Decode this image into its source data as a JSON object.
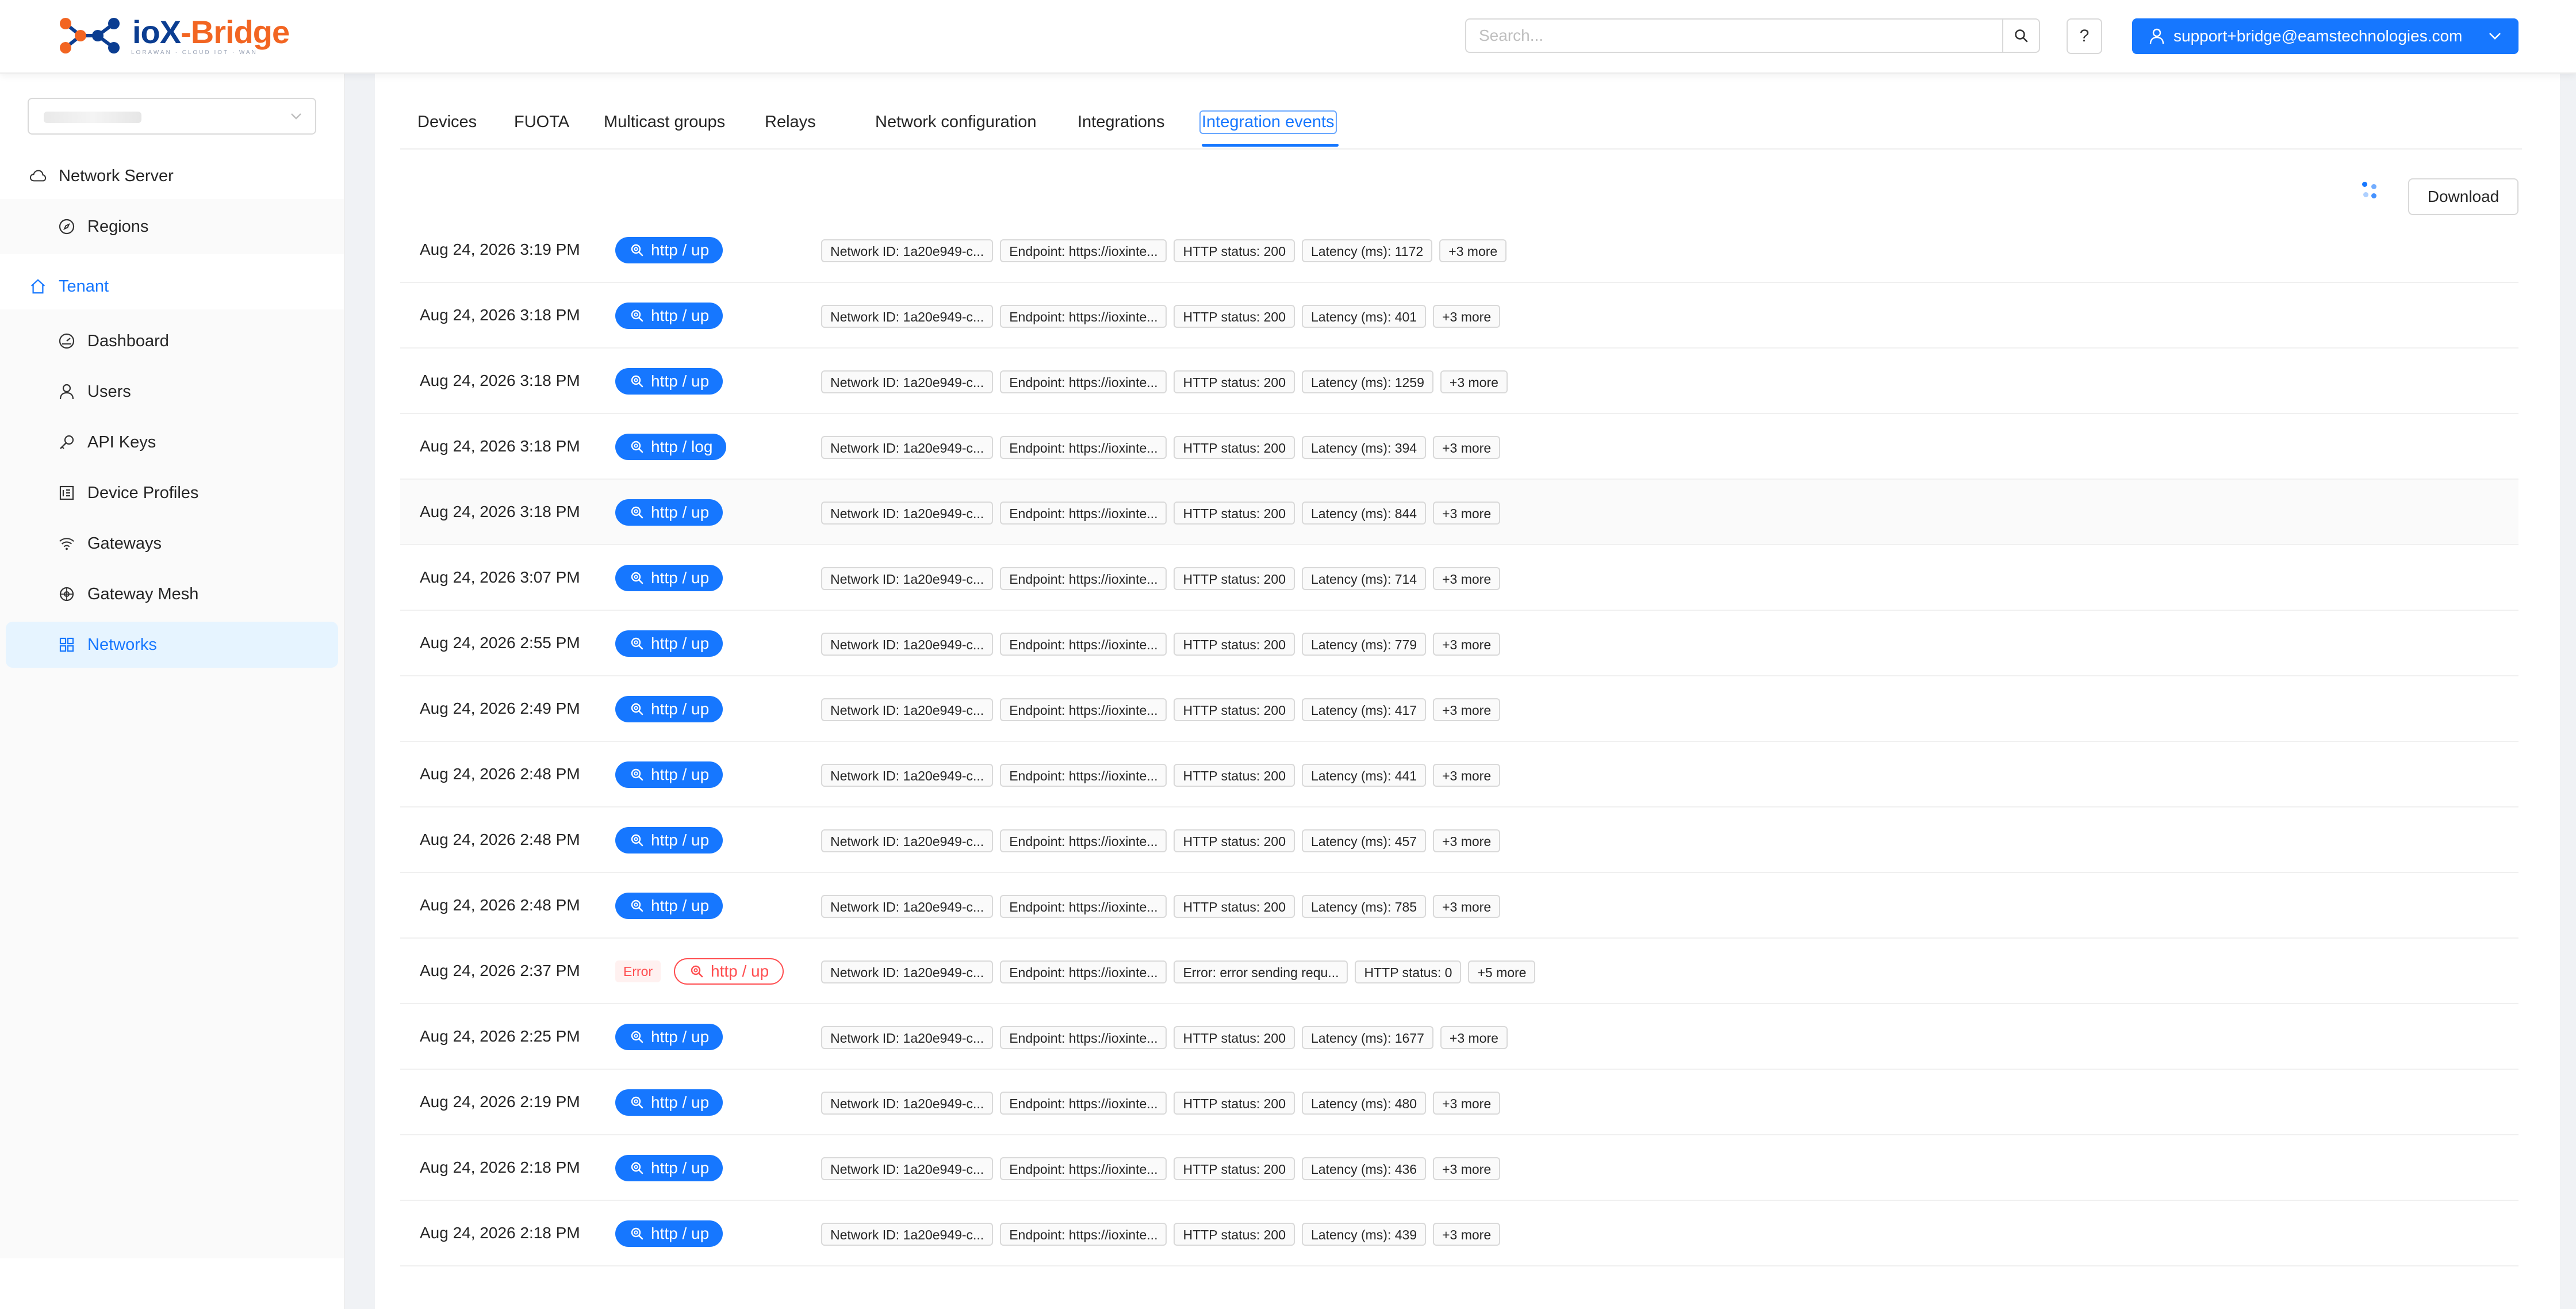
{
  "brand": {
    "name_part1": "ioX",
    "name_part2": "-Bridge",
    "tagline": "LORAWAN · CLOUD IOT · WAN",
    "colors": {
      "primary": "#0b3d91",
      "accent": "#f26522"
    }
  },
  "header": {
    "search_placeholder": "Search...",
    "search_icon": "search-icon",
    "help_label": "?",
    "user_email": "support+bridge@eamstechnologies.com"
  },
  "sidebar": {
    "tenant_select_value": "",
    "network_server": {
      "label": "Network Server",
      "icon": "cloud-icon"
    },
    "regions": {
      "label": "Regions",
      "icon": "compass-icon"
    },
    "tenant": {
      "label": "Tenant",
      "icon": "home-icon"
    },
    "items": [
      {
        "label": "Dashboard",
        "icon": "dashboard-icon"
      },
      {
        "label": "Users",
        "icon": "user-icon"
      },
      {
        "label": "API Keys",
        "icon": "key-icon"
      },
      {
        "label": "Device Profiles",
        "icon": "profile-icon"
      },
      {
        "label": "Gateways",
        "icon": "wifi-icon"
      },
      {
        "label": "Gateway Mesh",
        "icon": "mesh-icon"
      },
      {
        "label": "Networks",
        "icon": "appstore-icon",
        "selected": true
      }
    ]
  },
  "tabs": [
    {
      "label": "Devices"
    },
    {
      "label": "FUOTA"
    },
    {
      "label": "Multicast groups"
    },
    {
      "label": "Relays"
    },
    {
      "label": "Network configuration"
    },
    {
      "label": "Integrations"
    },
    {
      "label": "Integration events",
      "active": true
    }
  ],
  "toolbar": {
    "download_label": "Download"
  },
  "colors": {
    "accent": "#1677ff",
    "error": "#ff4d4f"
  },
  "events": [
    {
      "time": "Aug 24, 2026 3:19 PM",
      "type": "http / up",
      "tags": [
        "Network ID: 1a20e949-c...",
        "Endpoint: https://ioxinte...",
        "HTTP status: 200",
        "Latency (ms): 1172",
        "+3 more"
      ]
    },
    {
      "time": "Aug 24, 2026 3:18 PM",
      "type": "http / up",
      "tags": [
        "Network ID: 1a20e949-c...",
        "Endpoint: https://ioxinte...",
        "HTTP status: 200",
        "Latency (ms): 401",
        "+3 more"
      ]
    },
    {
      "time": "Aug 24, 2026 3:18 PM",
      "type": "http / up",
      "tags": [
        "Network ID: 1a20e949-c...",
        "Endpoint: https://ioxinte...",
        "HTTP status: 200",
        "Latency (ms): 1259",
        "+3 more"
      ]
    },
    {
      "time": "Aug 24, 2026 3:18 PM",
      "type": "http / log",
      "tags": [
        "Network ID: 1a20e949-c...",
        "Endpoint: https://ioxinte...",
        "HTTP status: 200",
        "Latency (ms): 394",
        "+3 more"
      ]
    },
    {
      "time": "Aug 24, 2026 3:18 PM",
      "type": "http / up",
      "tags": [
        "Network ID: 1a20e949-c...",
        "Endpoint: https://ioxinte...",
        "HTTP status: 200",
        "Latency (ms): 844",
        "+3 more"
      ]
    },
    {
      "time": "Aug 24, 2026 3:07 PM",
      "type": "http / up",
      "tags": [
        "Network ID: 1a20e949-c...",
        "Endpoint: https://ioxinte...",
        "HTTP status: 200",
        "Latency (ms): 714",
        "+3 more"
      ]
    },
    {
      "time": "Aug 24, 2026 2:55 PM",
      "type": "http / up",
      "tags": [
        "Network ID: 1a20e949-c...",
        "Endpoint: https://ioxinte...",
        "HTTP status: 200",
        "Latency (ms): 779",
        "+3 more"
      ]
    },
    {
      "time": "Aug 24, 2026 2:49 PM",
      "type": "http / up",
      "tags": [
        "Network ID: 1a20e949-c...",
        "Endpoint: https://ioxinte...",
        "HTTP status: 200",
        "Latency (ms): 417",
        "+3 more"
      ]
    },
    {
      "time": "Aug 24, 2026 2:48 PM",
      "type": "http / up",
      "tags": [
        "Network ID: 1a20e949-c...",
        "Endpoint: https://ioxinte...",
        "HTTP status: 200",
        "Latency (ms): 441",
        "+3 more"
      ]
    },
    {
      "time": "Aug 24, 2026 2:48 PM",
      "type": "http / up",
      "tags": [
        "Network ID: 1a20e949-c...",
        "Endpoint: https://ioxinte...",
        "HTTP status: 200",
        "Latency (ms): 457",
        "+3 more"
      ]
    },
    {
      "time": "Aug 24, 2026 2:48 PM",
      "type": "http / up",
      "tags": [
        "Network ID: 1a20e949-c...",
        "Endpoint: https://ioxinte...",
        "HTTP status: 200",
        "Latency (ms): 785",
        "+3 more"
      ]
    },
    {
      "time": "Aug 24, 2026 2:37 PM",
      "type": "http / up",
      "error_label": "Error",
      "tags": [
        "Network ID: 1a20e949-c...",
        "Endpoint: https://ioxinte...",
        "Error: error sending requ...",
        "HTTP status: 0",
        "+5 more"
      ]
    },
    {
      "time": "Aug 24, 2026 2:25 PM",
      "type": "http / up",
      "tags": [
        "Network ID: 1a20e949-c...",
        "Endpoint: https://ioxinte...",
        "HTTP status: 200",
        "Latency (ms): 1677",
        "+3 more"
      ]
    },
    {
      "time": "Aug 24, 2026 2:19 PM",
      "type": "http / up",
      "tags": [
        "Network ID: 1a20e949-c...",
        "Endpoint: https://ioxinte...",
        "HTTP status: 200",
        "Latency (ms): 480",
        "+3 more"
      ]
    },
    {
      "time": "Aug 24, 2026 2:18 PM",
      "type": "http / up",
      "tags": [
        "Network ID: 1a20e949-c...",
        "Endpoint: https://ioxinte...",
        "HTTP status: 200",
        "Latency (ms): 436",
        "+3 more"
      ]
    },
    {
      "time": "Aug 24, 2026 2:18 PM",
      "type": "http / up",
      "tags": [
        "Network ID: 1a20e949-c...",
        "Endpoint: https://ioxinte...",
        "HTTP status: 200",
        "Latency (ms): 439",
        "+3 more"
      ]
    }
  ]
}
